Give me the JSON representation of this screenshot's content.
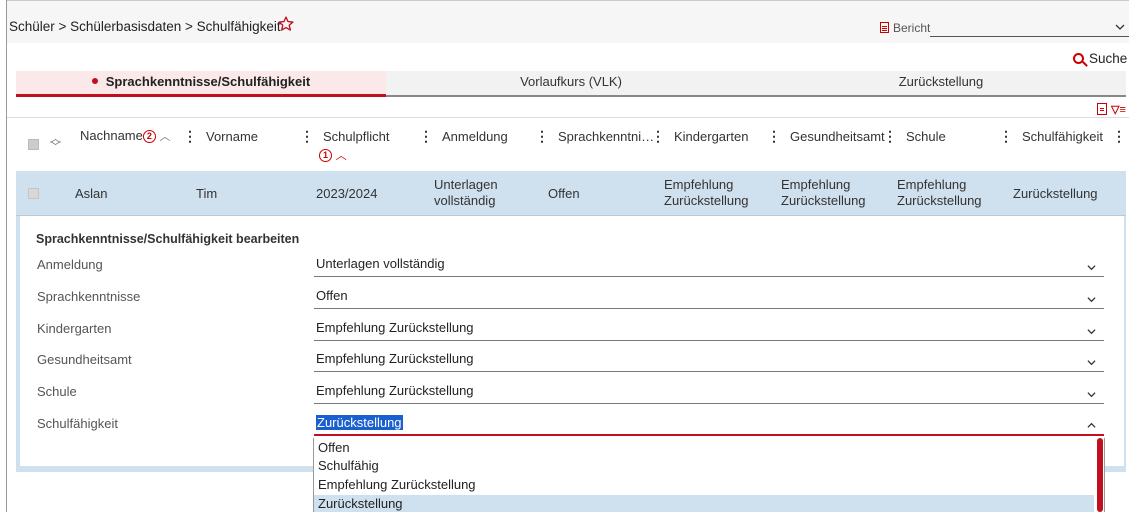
{
  "breadcrumb": "Schüler > Schülerbasisdaten > Schulfähigkeit",
  "bericht": {
    "label": "Bericht",
    "value": ""
  },
  "search": {
    "label": "Suche"
  },
  "tabs": [
    {
      "label": "Sprachkenntnisse/Schulfähigkeit",
      "active": true
    },
    {
      "label": "Vorlaufkurs (VLK)",
      "active": false
    },
    {
      "label": "Zurückstellung",
      "active": false
    }
  ],
  "columns": {
    "nachname": "Nachname",
    "nachname_badge": "2",
    "vorname": "Vorname",
    "schulpflicht": "Schulpflicht",
    "schulpflicht_badge": "1",
    "anmeldung": "Anmeldung",
    "sprachkenntnisse": "Sprachkenntni…",
    "kindergarten": "Kindergarten",
    "gesundheitsamt": "Gesundheitsamt",
    "schule": "Schule",
    "schulfaehigkeit": "Schulfähigkeit"
  },
  "row": {
    "nachname": "Aslan",
    "vorname": "Tim",
    "schulpflicht": "2023/2024",
    "anmeldung_1": "Unterlagen",
    "anmeldung_2": "vollständig",
    "sprachkenntnisse": "Offen",
    "kindergarten_1": "Empfehlung",
    "kindergarten_2": "Zurückstellung",
    "gesundheitsamt_1": "Empfehlung",
    "gesundheitsamt_2": "Zurückstellung",
    "schule_1": "Empfehlung",
    "schule_2": "Zurückstellung",
    "schulfaehigkeit": "Zurückstellung"
  },
  "edit": {
    "title": "Sprachkenntnisse/Schulfähigkeit bearbeiten",
    "fields": [
      {
        "label": "Anmeldung",
        "value": "Unterlagen vollständig"
      },
      {
        "label": "Sprachkenntnisse",
        "value": "Offen"
      },
      {
        "label": "Kindergarten",
        "value": "Empfehlung Zurückstellung"
      },
      {
        "label": "Gesundheitsamt",
        "value": "Empfehlung Zurückstellung"
      },
      {
        "label": "Schule",
        "value": "Empfehlung Zurückstellung"
      },
      {
        "label": "Schulfähigkeit",
        "value": "Zurückstellung"
      }
    ],
    "options": [
      "Offen",
      "Schulfähig",
      "Empfehlung Zurückstellung",
      "Zurückstellung"
    ]
  },
  "colors": {
    "accent": "#c01020",
    "row_highlight": "#cfe0ee",
    "selection": "#1a5fd0"
  }
}
